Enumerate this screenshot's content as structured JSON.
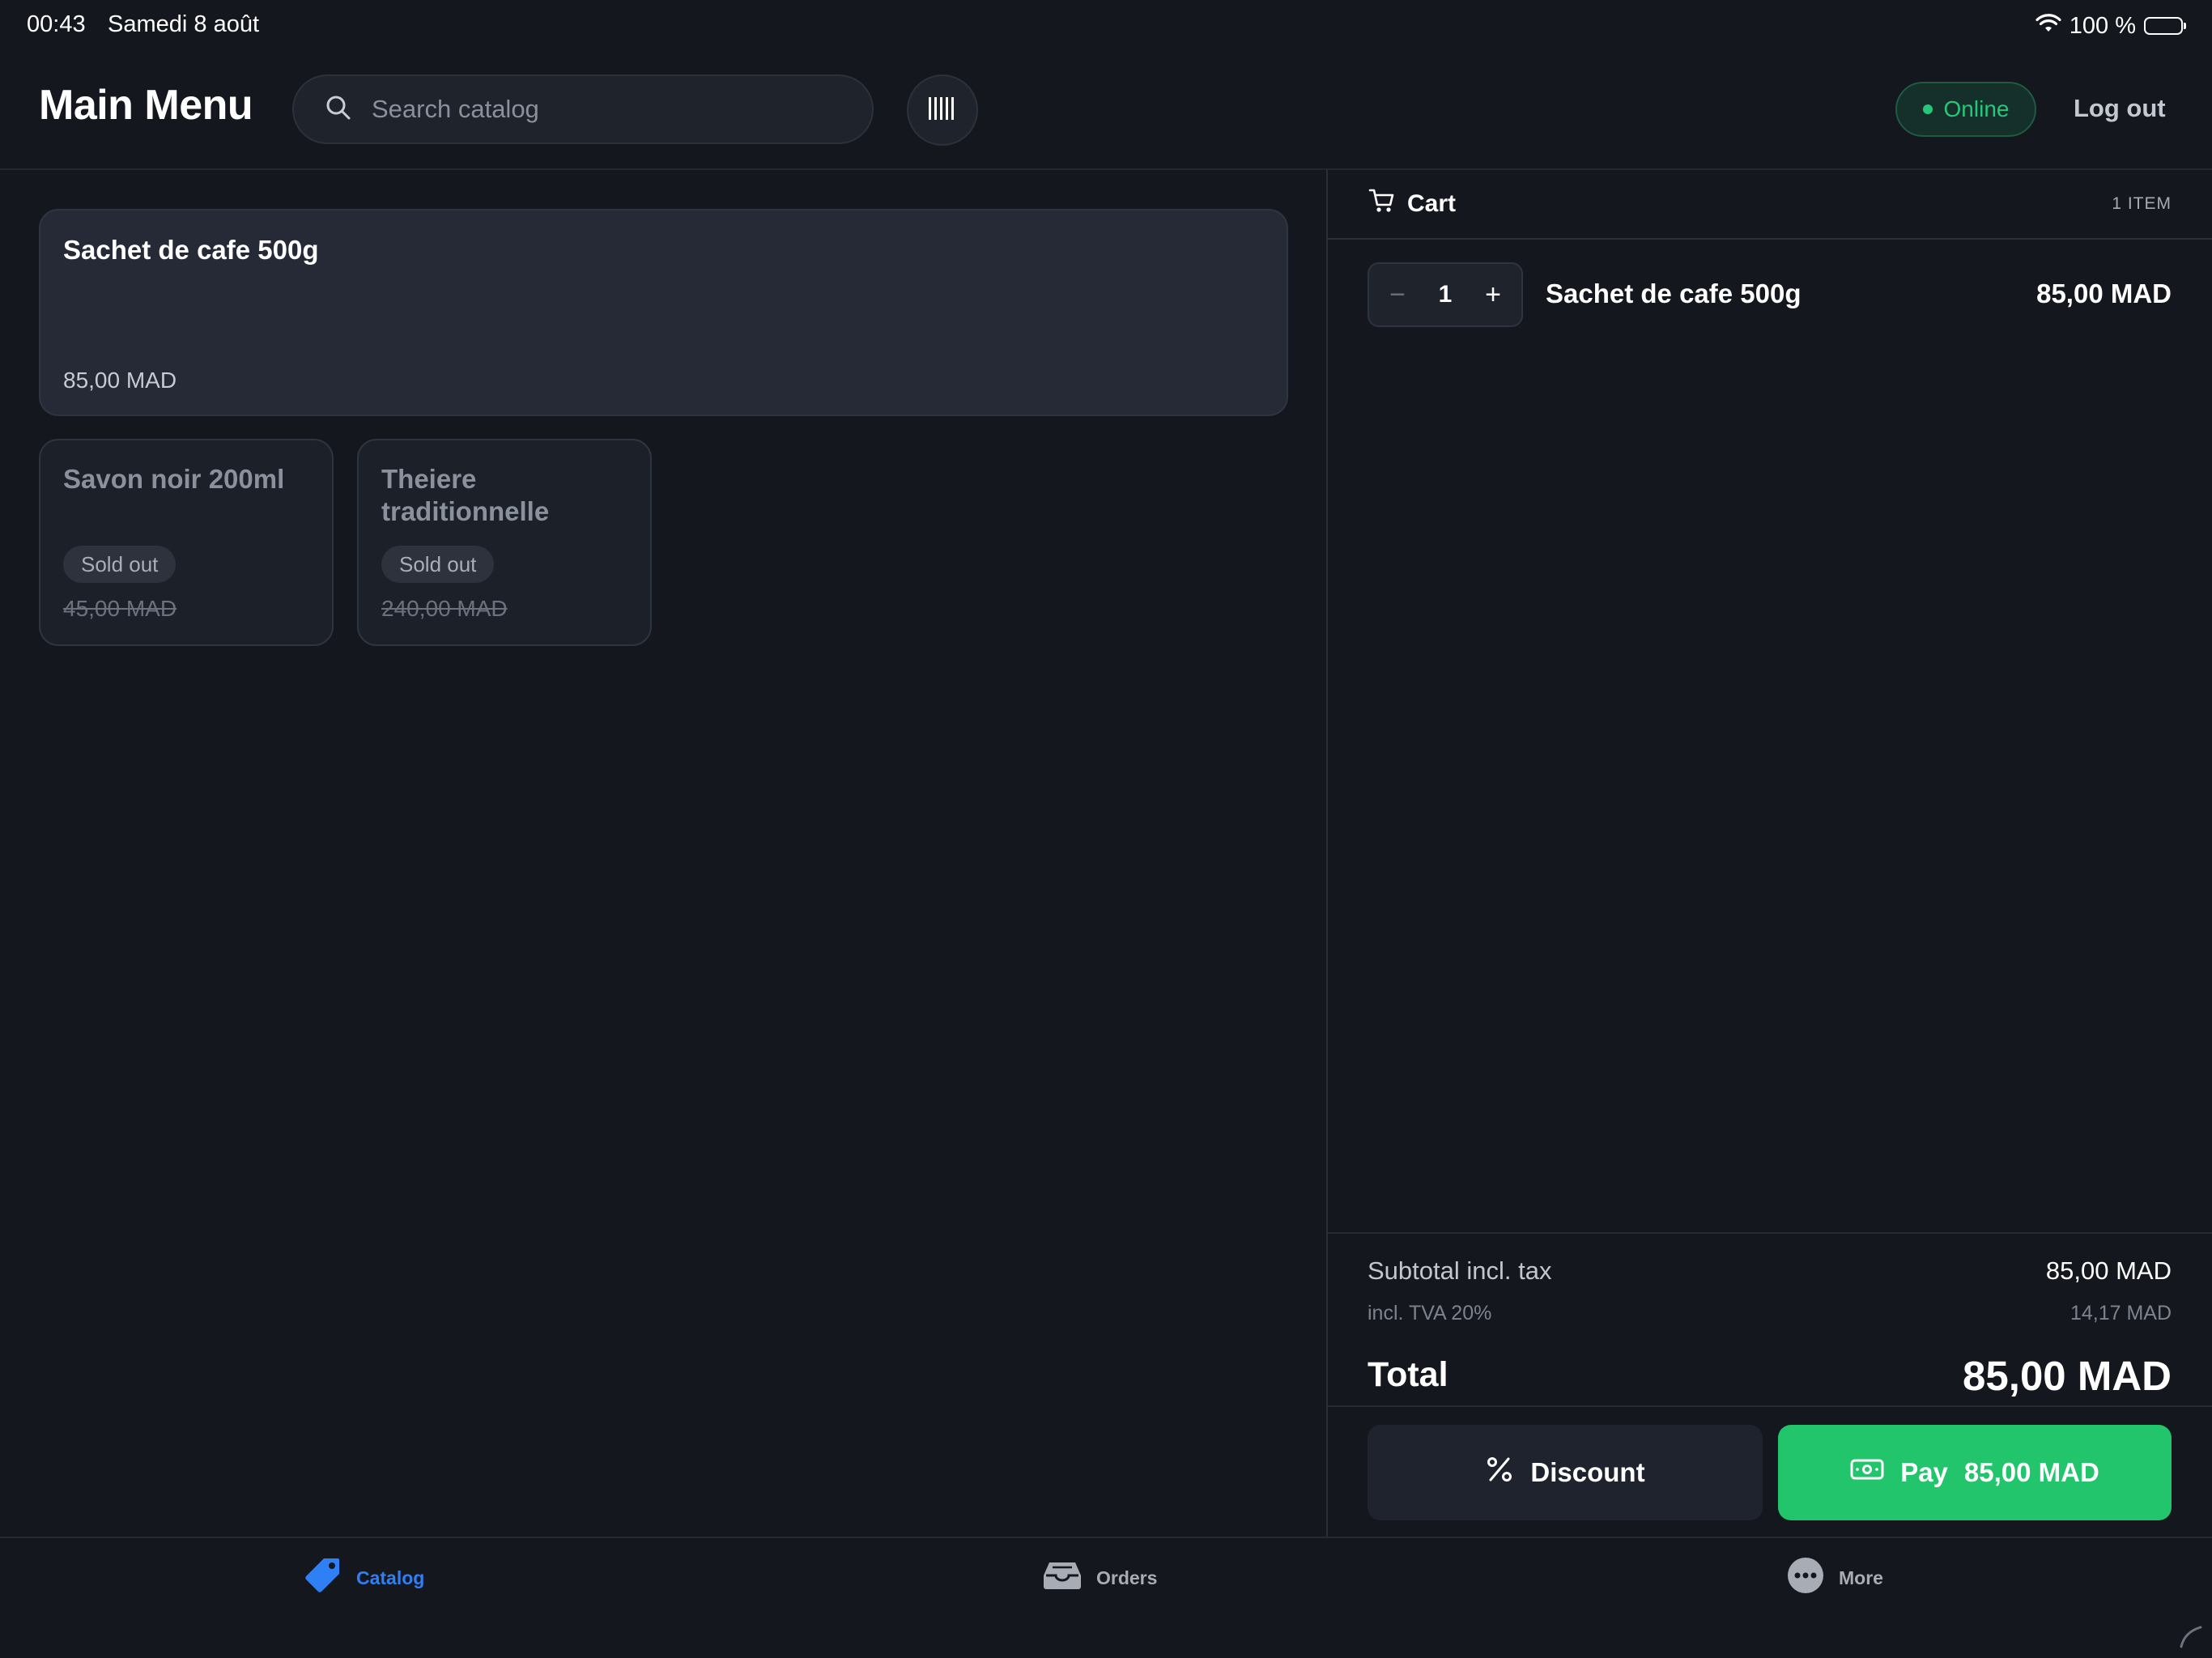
{
  "status_bar": {
    "time": "00:43",
    "date": "Samedi 8 août",
    "battery": "100 %",
    "wifi_icon": "wifi-icon",
    "battery_icon": "battery-icon"
  },
  "header": {
    "title": "Main Menu",
    "search_placeholder": "Search catalog",
    "barcode_icon": "barcode-icon",
    "status_label": "Online",
    "logout_label": "Log out"
  },
  "catalog": {
    "featured": {
      "name": "Sachet de cafe 500g",
      "price": "85,00 MAD"
    },
    "sold_out_items": [
      {
        "name": "Savon noir 200ml",
        "badge": "Sold out",
        "price": "45,00 MAD"
      },
      {
        "name": "Theiere traditionnelle",
        "badge": "Sold out",
        "price": "240,00 MAD"
      }
    ]
  },
  "cart": {
    "title": "Cart",
    "count_label": "1 ITEM",
    "lines": [
      {
        "qty": "1",
        "name": "Sachet de cafe 500g",
        "price": "85,00 MAD"
      }
    ],
    "minus_symbol": "−",
    "plus_symbol": "+",
    "subtotal_label": "Subtotal incl. tax",
    "subtotal_value": "85,00 MAD",
    "tax_label": "incl. TVA 20%",
    "tax_value": "14,17 MAD",
    "total_label": "Total",
    "total_value": "85,00 MAD",
    "discount_label": "Discount",
    "pay_label": "Pay",
    "pay_amount": "85,00 MAD"
  },
  "tabs": [
    {
      "label": "Catalog",
      "icon": "tag-icon",
      "active": true
    },
    {
      "label": "Orders",
      "icon": "inbox-icon",
      "active": false
    },
    {
      "label": "More",
      "icon": "more-icon",
      "active": false
    }
  ],
  "colors": {
    "background": "#14171d",
    "accent_green": "#22c46c",
    "accent_blue": "#2f7ff5",
    "online_green": "#27c77a"
  }
}
